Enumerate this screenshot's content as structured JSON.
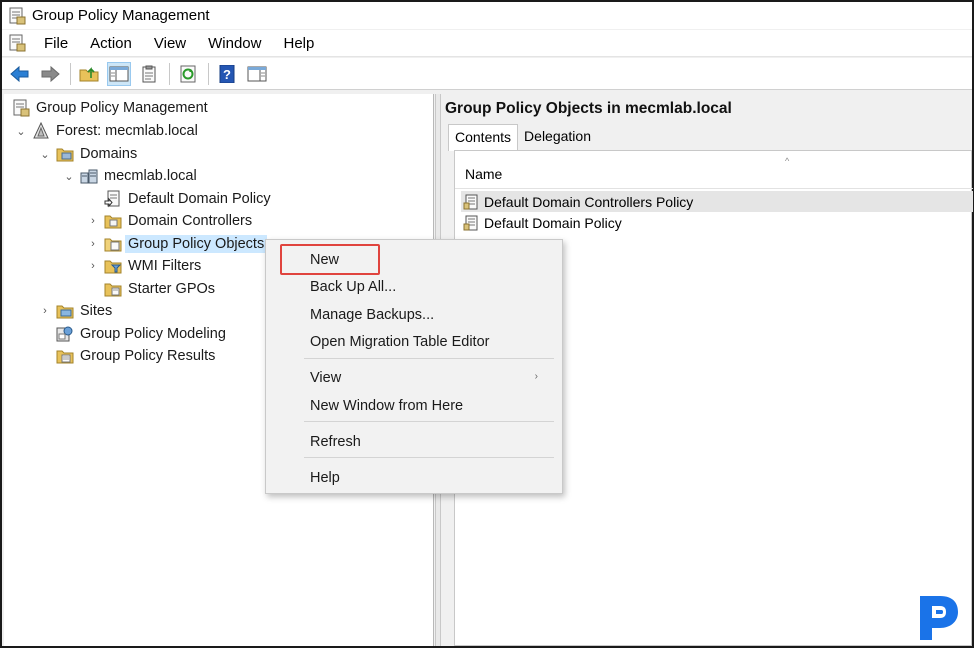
{
  "window": {
    "title": "Group Policy Management"
  },
  "menubar": {
    "items": [
      "File",
      "Action",
      "View",
      "Window",
      "Help"
    ]
  },
  "toolbar": {
    "buttons": [
      "back-arrow-icon",
      "forward-arrow-icon",
      "up-folder-icon",
      "show-hide-tree-icon",
      "properties-icon",
      "refresh-icon",
      "help-icon",
      "action-pane-icon"
    ]
  },
  "tree": {
    "root": "Group Policy Management",
    "forest": "Forest: mecmlab.local",
    "domains": "Domains",
    "domain": "mecmlab.local",
    "default_domain_policy": "Default Domain Policy",
    "domain_controllers": "Domain Controllers",
    "group_policy_objects": "Group Policy Objects",
    "wmi_filters": "WMI Filters",
    "starter_gpos": "Starter GPOs",
    "sites": "Sites",
    "modeling": "Group Policy Modeling",
    "results": "Group Policy Results"
  },
  "right_pane": {
    "title": "Group Policy Objects in mecmlab.local",
    "tabs": [
      "Contents",
      "Delegation"
    ],
    "column_name": "Name",
    "rows": [
      "Default Domain Controllers Policy",
      "Default Domain Policy"
    ]
  },
  "context_menu": {
    "items": [
      {
        "label": "New"
      },
      {
        "label": "Back Up All..."
      },
      {
        "label": "Manage Backups..."
      },
      {
        "label": "Open Migration Table Editor"
      },
      {
        "label": "View"
      },
      {
        "label": "New Window from Here"
      },
      {
        "label": "Refresh"
      },
      {
        "label": "Help"
      }
    ],
    "highlight_color": "#e0443e"
  },
  "colors": {
    "selection": "#cce8ff",
    "folder": "#e8c25a",
    "logo": "#1a73e8"
  }
}
